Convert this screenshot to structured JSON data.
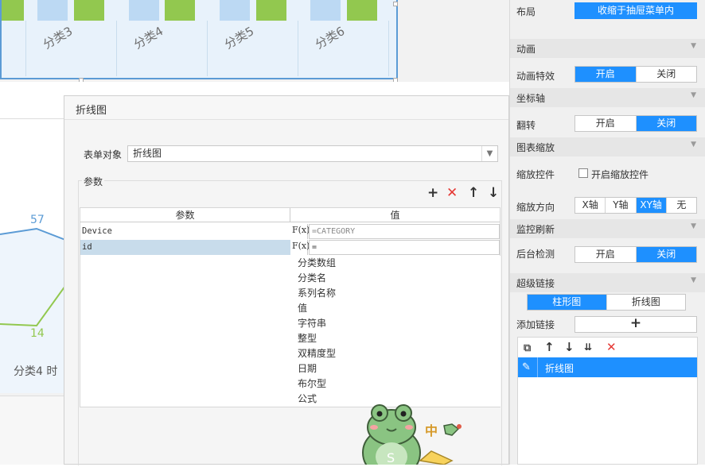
{
  "bar_chart": {
    "category_labels": [
      "分类3",
      "分类4",
      "分类5",
      "分类6"
    ]
  },
  "line_chart": {
    "value_labels": [
      "57",
      "14"
    ],
    "category_label": "分类4 时"
  },
  "dialog": {
    "title": "折线图",
    "form_label": "表单对象",
    "form_value": "折线图",
    "params_legend": "参数",
    "col_param": "参数",
    "col_value": "值",
    "rows": [
      {
        "param": "Device",
        "value": "=CATEGORY"
      },
      {
        "param": "id",
        "value": "="
      }
    ],
    "fx_label": "F(x)",
    "type_options": [
      "分类数组",
      "分类名",
      "系列名称",
      "值",
      "字符串",
      "整型",
      "双精度型",
      "日期",
      "布尔型",
      "公式"
    ],
    "toolbar_icons": [
      "plus-icon",
      "delete-icon",
      "arrow-up-icon",
      "arrow-down-icon"
    ]
  },
  "props": {
    "layout_label": "布局",
    "layout_value": "收缩于抽屉菜单内",
    "sec_animation": "动画",
    "anim_effect_label": "动画特效",
    "anim_effect_options": [
      "开启",
      "关闭"
    ],
    "sec_axis": "坐标轴",
    "flip_label": "翻转",
    "flip_options": [
      "开启",
      "关闭"
    ],
    "sec_zoom": "图表缩放",
    "zoom_control_label": "缩放控件",
    "zoom_control_checkbox": "开启缩放控件",
    "zoom_dir_label": "缩放方向",
    "zoom_dir_options": [
      "X轴",
      "Y轴",
      "XY轴",
      "无"
    ],
    "sec_monitor": "监控刷新",
    "bg_check_label": "后台检测",
    "bg_check_options": [
      "开启",
      "关闭"
    ],
    "sec_hyperlink": "超级链接",
    "link_tabs": [
      "柱形图",
      "折线图"
    ],
    "add_link_label": "添加链接",
    "add_link_button": "+",
    "link_item": "折线图",
    "selected": {
      "anim_effect": "开启",
      "flip": "关闭",
      "zoom_dir": "XY轴",
      "bg_check": "关闭",
      "link_tab": "柱形图"
    }
  },
  "sticker_text": "中",
  "colors": {
    "accent": "#1e90ff",
    "delete": "#e53935",
    "bar_blue": "#bcd9f3",
    "bar_green": "#92c84f",
    "line_blue": "#5b9bd5",
    "line_green": "#92c84f"
  }
}
